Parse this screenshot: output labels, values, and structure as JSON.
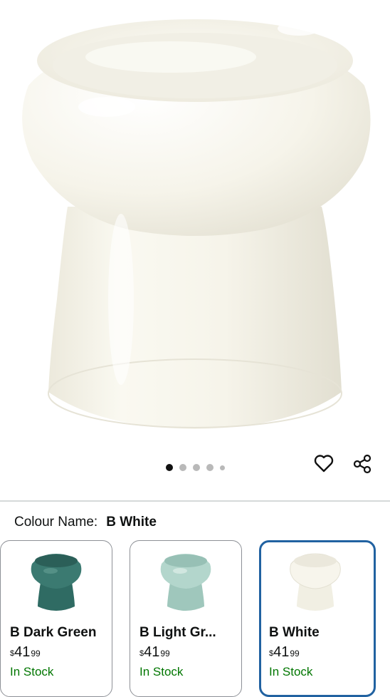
{
  "product": {
    "image_alt": "Raised ceramic pet bowl",
    "carousel": {
      "total": 5,
      "active": 1
    }
  },
  "actions": {
    "wishlist_icon": "heart-icon",
    "share_icon": "share-icon"
  },
  "variation": {
    "label": "Colour Name:",
    "selected_value": "B White",
    "options": [
      {
        "name": "B Dark Green",
        "currency": "$",
        "whole": "41",
        "fraction": "99",
        "stock": "In Stock",
        "color": "#2f6b63"
      },
      {
        "name": "B Light Gr...",
        "currency": "$",
        "whole": "41",
        "fraction": "99",
        "stock": "In Stock",
        "color": "#a9cfc4"
      },
      {
        "name": "B White",
        "currency": "$",
        "whole": "41",
        "fraction": "99",
        "stock": "In Stock",
        "color": "#f3f1e6"
      }
    ]
  },
  "colors": {
    "accent_border": "#2162a1",
    "stock_green": "#007600"
  }
}
